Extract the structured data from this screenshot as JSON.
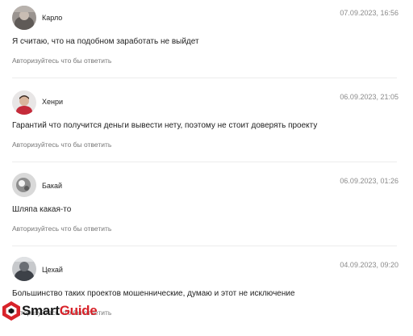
{
  "comments": [
    {
      "author": "Карло",
      "date": "07.09.2023, 16:56",
      "text": "Я считаю, что на подобном заработать не выйдет",
      "reply_label": "Авторизуйтесь что бы ответить",
      "avatar": "avatar-photo-grey"
    },
    {
      "author": "Хенри",
      "date": "06.09.2023, 21:05",
      "text": "Гарантий что получится деньги вывести нету, поэтому не стоит доверять проекту",
      "reply_label": "Авторизуйтесь что бы ответить",
      "avatar": "avatar-photo-red"
    },
    {
      "author": "Бакай",
      "date": "06.09.2023, 01:26",
      "text": "Шляпа какая-то",
      "reply_label": "Авторизуйтесь что бы ответить",
      "avatar": "avatar-photo-light"
    },
    {
      "author": "Цехай",
      "date": "04.09.2023, 09:20",
      "text": "Большинство таких проектов мошеннические, думаю и этот не исключение",
      "reply_label": "Авторизуйтесь что бы ответить",
      "avatar": "avatar-photo-dark"
    }
  ],
  "watermark": {
    "part1": "Smart",
    "part2": "Guide",
    "icon": "smartguide-logo-icon",
    "color_primary": "#1a1a1a",
    "color_accent": "#d8232a"
  }
}
